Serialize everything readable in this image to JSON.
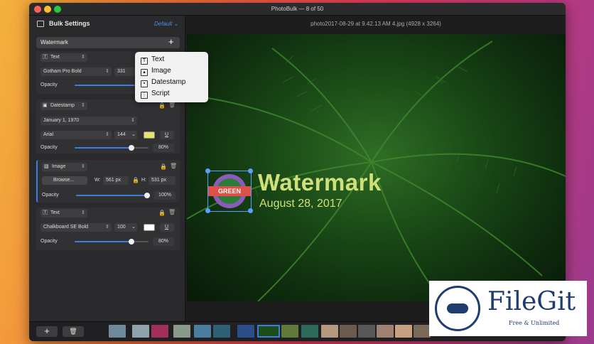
{
  "window": {
    "title": "PhotoBulk — 8 of 50"
  },
  "sidebar": {
    "title": "Bulk Settings",
    "preset": "Default",
    "section": "Watermark",
    "add_label": "+"
  },
  "toolbar": {
    "filename": "photo2017-08-29 at 9.42.13 AM 4.jpg (4928 x 3264)"
  },
  "panels": {
    "text1": {
      "type": "Text",
      "font": "Gotham Pro Bold",
      "size": "331",
      "opacity_label": "Opacity"
    },
    "datestamp": {
      "type": "Datestamp",
      "date_format": "January 1, 1970",
      "font": "Arial",
      "size": "144",
      "underline": "U",
      "opacity_label": "Opacity",
      "opacity": "80%",
      "opacity_value": 0.8,
      "color": "#e7e36a"
    },
    "image": {
      "type": "Image",
      "browse": "Browse...",
      "width_label": "W:",
      "width": "561 px",
      "height_label": "H:",
      "height": "531 px",
      "opacity_label": "Opacity",
      "opacity": "100%",
      "opacity_value": 1.0
    },
    "text2": {
      "type": "Text",
      "font": "Chalkboard SE Bold",
      "size": "100",
      "underline": "U",
      "opacity_label": "Opacity",
      "opacity": "80%",
      "opacity_value": 0.8,
      "color": "#ffffff"
    }
  },
  "popup": {
    "items": [
      {
        "label": "Text",
        "icon": "text-icon"
      },
      {
        "label": "Image",
        "icon": "image-icon"
      },
      {
        "label": "Datestamp",
        "icon": "calendar-icon"
      },
      {
        "label": "Script",
        "icon": "script-icon"
      }
    ]
  },
  "preview": {
    "watermark_text": "Watermark",
    "date_text": "August 28, 2017",
    "badge_text": "GREEN"
  },
  "bottom": {
    "add_label": "+",
    "delete_icon": "trash-icon"
  },
  "logo": {
    "name": "FileGit",
    "tagline": "Free & Unlimited"
  },
  "colors": {
    "accent": "#3a7fe0",
    "watermark": "#cfe07a",
    "badge_red": "#e0504a",
    "badge_purple": "#8a5bb8"
  }
}
